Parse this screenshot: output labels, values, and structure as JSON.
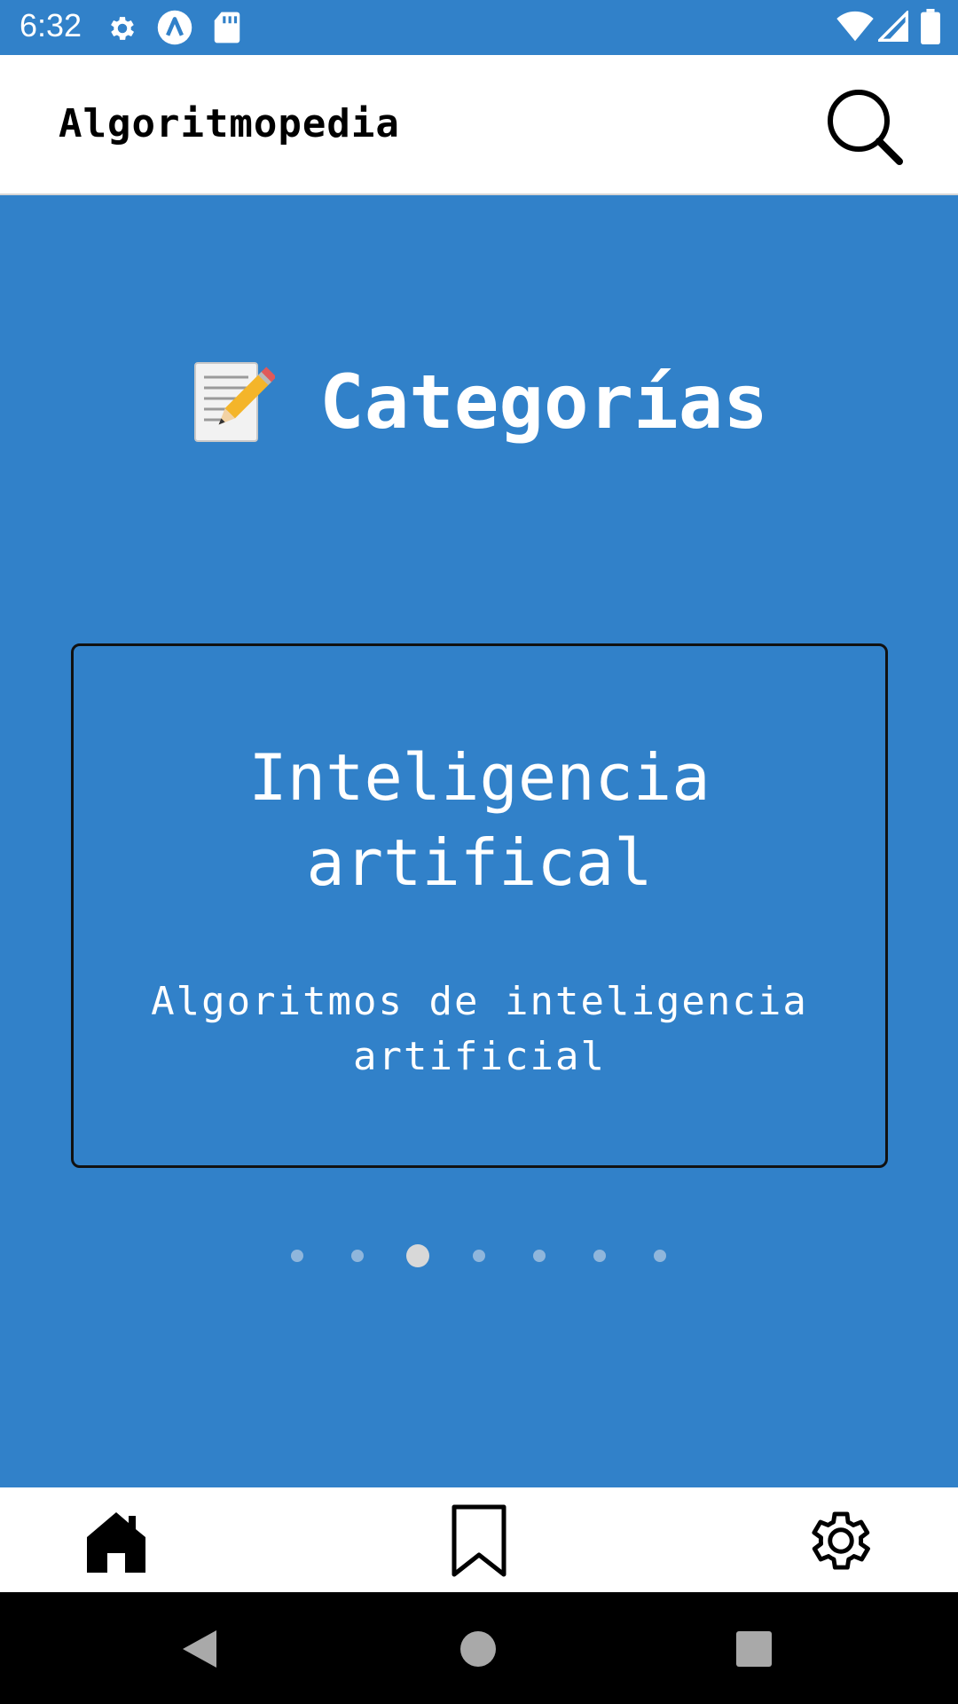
{
  "status_bar": {
    "time": "6:32",
    "left_icons": [
      "gear-icon",
      "app-a-icon",
      "sd-card-icon"
    ],
    "right_icons": [
      "wifi-icon",
      "signal-icon",
      "battery-icon"
    ]
  },
  "app_bar": {
    "title": "Algoritmopedia",
    "search_icon": "search-icon"
  },
  "main": {
    "heading_emoji": "memo-pencil-icon",
    "heading": "Categorías",
    "card": {
      "title_line1": "Inteligencia",
      "title_line2": "artifical",
      "desc_line1": "Algoritmos de inteligencia",
      "desc_line2": "artificial"
    },
    "carousel": {
      "total": 7,
      "active_index": 2
    }
  },
  "bottom_nav": {
    "items": [
      "home-icon",
      "bookmark-icon",
      "settings-icon"
    ]
  },
  "system_nav": {
    "items": [
      "back-icon",
      "home-circle-icon",
      "recents-icon"
    ]
  },
  "colors": {
    "accent": "#3181C9",
    "surface": "#FFFFFF",
    "system_bar": "#000000"
  }
}
